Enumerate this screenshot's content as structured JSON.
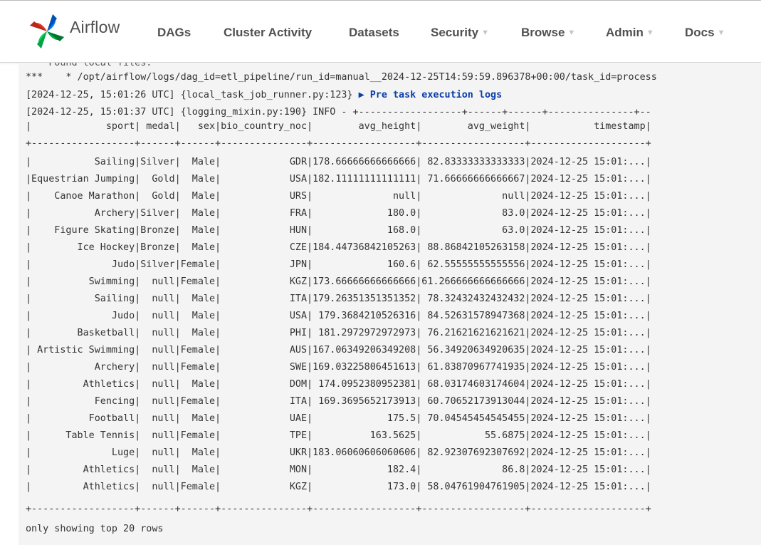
{
  "navbar": {
    "brand": "Airflow",
    "items": [
      {
        "label": "DAGs",
        "has_caret": false
      },
      {
        "label": "Cluster Activity",
        "has_caret": false
      },
      {
        "label": "Datasets",
        "has_caret": false
      },
      {
        "label": "Security",
        "has_caret": true
      },
      {
        "label": "Browse",
        "has_caret": true
      },
      {
        "label": "Admin",
        "has_caret": true
      },
      {
        "label": "Docs",
        "has_caret": true
      }
    ]
  },
  "log": {
    "cut_line": "    Found local files:",
    "path_line": "***    * /opt/airflow/logs/dag_id=etl_pipeline/run_id=manual__2024-12-25T14:59:59.896378+00:00/task_id=process",
    "pre_task_prefix": "[2024-12-25, 15:01:26 UTC] {local_task_job_runner.py:123} ",
    "pre_task_marker": "▶ Pre task execution logs",
    "info_line": "[2024-12-25, 15:01:37 UTC] {logging_mixin.py:190} INFO - +------------------+------+------+---------------+--",
    "header_row": "|             sport| medal|   sex|bio_country_noc|        avg_height|        avg_weight|           timestamp|",
    "separator": "+------------------+------+------+---------------+------------------+------------------+--------------------+",
    "rows": [
      "|           Sailing|Silver|  Male|            GDR|178.66666666666666| 82.83333333333333|2024-12-25 15:01:...|",
      "|Equestrian Jumping|  Gold|  Male|            USA|182.11111111111111| 71.66666666666667|2024-12-25 15:01:...|",
      "|    Canoe Marathon|  Gold|  Male|            URS|              null|              null|2024-12-25 15:01:...|",
      "|           Archery|Silver|  Male|            FRA|             180.0|              83.0|2024-12-25 15:01:...|",
      "|    Figure Skating|Bronze|  Male|            HUN|             168.0|              63.0|2024-12-25 15:01:...|",
      "|        Ice Hockey|Bronze|  Male|            CZE|184.44736842105263| 88.86842105263158|2024-12-25 15:01:...|",
      "|              Judo|Silver|Female|            JPN|             160.6| 62.55555555555556|2024-12-25 15:01:...|",
      "|          Swimming|  null|Female|            KGZ|173.66666666666666|61.266666666666666|2024-12-25 15:01:...|",
      "|           Sailing|  null|  Male|            ITA|179.26351351351352| 78.32432432432432|2024-12-25 15:01:...|",
      "|              Judo|  null|  Male|            USA| 179.3684210526316| 84.52631578947368|2024-12-25 15:01:...|",
      "|        Basketball|  null|  Male|            PHI| 181.2972972972973| 76.21621621621621|2024-12-25 15:01:...|",
      "| Artistic Swimming|  null|Female|            AUS|167.06349206349208| 56.34920634920635|2024-12-25 15:01:...|",
      "|           Archery|  null|Female|            SWE|169.03225806451613| 61.83870967741935|2024-12-25 15:01:...|",
      "|         Athletics|  null|  Male|            DOM| 174.0952380952381| 68.03174603174604|2024-12-25 15:01:...|",
      "|           Fencing|  null|Female|            ITA| 169.3695652173913| 60.70652173913044|2024-12-25 15:01:...|",
      "|          Football|  null|  Male|            UAE|             175.5| 70.04545454545455|2024-12-25 15:01:...|",
      "|      Table Tennis|  null|Female|            TPE|          163.5625|           55.6875|2024-12-25 15:01:...|",
      "|              Luge|  null|  Male|            UKR|183.06060606060606| 82.92307692307692|2024-12-25 15:01:...|",
      "|         Athletics|  null|  Male|            MON|             182.4|              86.8|2024-12-25 15:01:...|",
      "|         Athletics|  null|Female|            KGZ|             173.0| 58.04761904761905|2024-12-25 15:01:...|"
    ],
    "footer": "only showing top 20 rows"
  },
  "colors": {
    "nav_text": "#51504f",
    "caret": "#c5c5c5",
    "log_bg": "#f4f4f4",
    "log_text": "#333333",
    "marker": "#0b3ea8",
    "logo_blue": "#017cee",
    "logo_green": "#00ad46",
    "logo_red": "#e43921",
    "logo_teal": "#04d659"
  }
}
